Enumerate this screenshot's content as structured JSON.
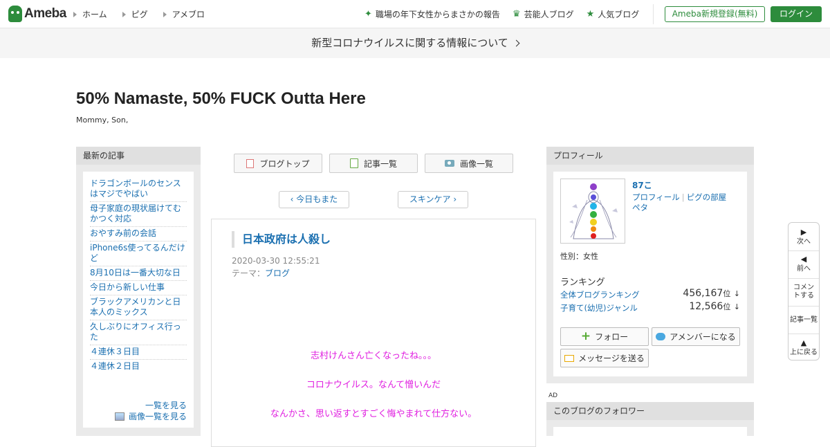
{
  "header": {
    "logo": "Ameba",
    "nav": [
      "ホーム",
      "ピグ",
      "アメブロ"
    ],
    "featured": [
      {
        "label": "職場の年下女性からまさかの報告",
        "icon": "sparkle-icon"
      },
      {
        "label": "芸能人ブログ",
        "icon": "crown-icon"
      },
      {
        "label": "人気ブログ",
        "icon": "star-icon"
      }
    ],
    "register_label": "Ameba新規登録(無料)",
    "login_label": "ログイン",
    "brand_color": "#2d8c3c"
  },
  "notice": {
    "text": "新型コロナウイルスに関する情報について"
  },
  "blog": {
    "title": "50% Namaste, 50% FUCK Outta Here",
    "subtitle": "Mommy, Son,"
  },
  "recent": {
    "heading": "最新の記事",
    "items": [
      "ドラゴンボールのセンスはマジでやばい",
      "母子家庭の現状届けてむかつく対応",
      "おやすみ前の会話",
      "iPhone6s使ってるんだけど",
      "8月10日は一番大切な日",
      "今日から新しい仕事",
      "ブラックアメリカンと日本人のミックス",
      "久しぶりにオフィス行った",
      "４連休３日目",
      "４連休２日目"
    ],
    "see_list": "一覧を見る",
    "see_images": "画像一覧を見る"
  },
  "tabs": [
    "ブログトップ",
    "記事一覧",
    "画像一覧"
  ],
  "pager": {
    "prev": "今日もまた",
    "next": "スキンケア"
  },
  "article": {
    "title": "日本政府は人殺し",
    "date": "2020-03-30 12:55:21",
    "theme_label": "テーマ：",
    "theme": "ブログ",
    "lines": [
      "志村けんさん亡くなったね。。。",
      "コロナウイルス。なんて憎いんだ",
      "なんかさ、思い返すとすごく悔やまれて仕方ない。"
    ],
    "text_color": "#e020e0"
  },
  "profile": {
    "heading": "プロフィール",
    "name": "87こ",
    "links": [
      "プロフィール",
      "ピグの部屋",
      "ペタ"
    ],
    "gender": "性別：女性",
    "ranking_heading": "ランキング",
    "rankings": [
      {
        "label": "全体ブログランキング",
        "value": "456,167",
        "unit": "位",
        "trend": "↓"
      },
      {
        "label": "子育て(幼児)ジャンル",
        "value": "12,566",
        "unit": "位",
        "trend": "↓"
      }
    ],
    "follow_label": "フォロー",
    "member_label": "アメンバーになる",
    "message_label": "メッセージを送る"
  },
  "ad_label": "AD",
  "followers": {
    "heading": "このブログのフォロワー"
  },
  "floating": [
    {
      "glyph": "▶",
      "label": "次へ"
    },
    {
      "glyph": "◀",
      "label": "前へ"
    },
    {
      "glyph": "",
      "label": "コメントする"
    },
    {
      "glyph": "",
      "label": "記事一覧"
    },
    {
      "glyph": "▲",
      "label": "上に戻る"
    }
  ]
}
